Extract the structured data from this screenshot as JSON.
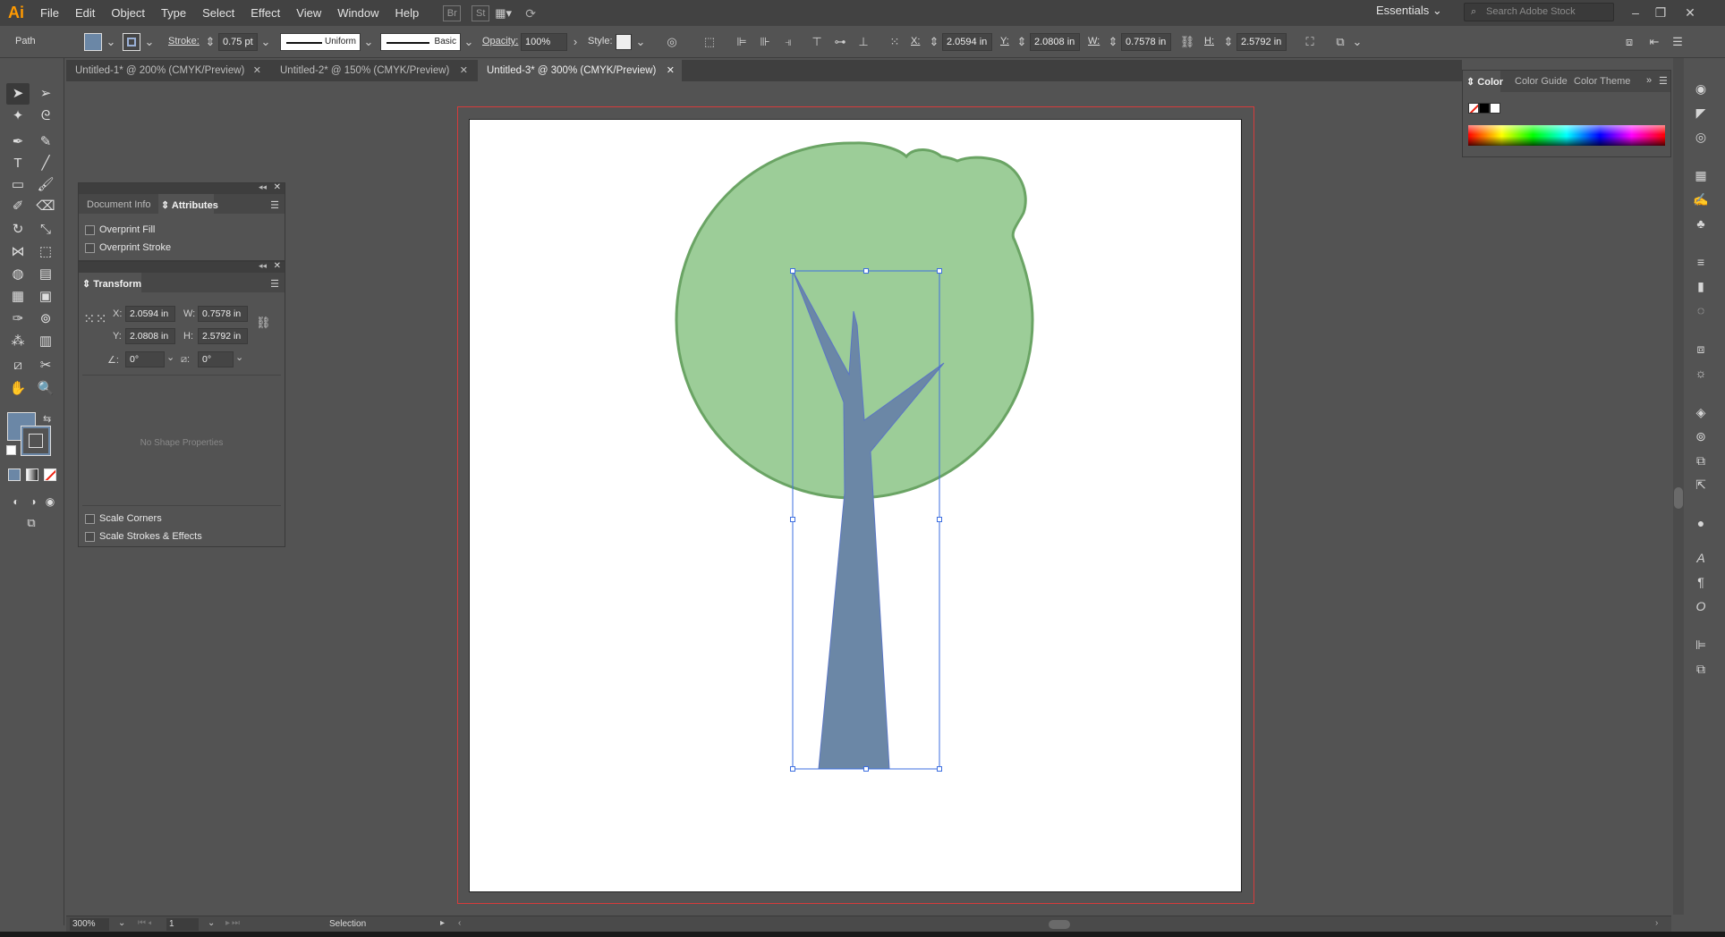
{
  "app": {
    "logo": "Ai"
  },
  "menu": [
    "File",
    "Edit",
    "Object",
    "Type",
    "Select",
    "Effect",
    "View",
    "Window",
    "Help"
  ],
  "menu_buttons": {
    "br": "Br",
    "st": "St"
  },
  "workspace": "Essentials",
  "stock_search": {
    "placeholder": "Search Adobe Stock"
  },
  "control": {
    "selection_type": "Path",
    "stroke_label": "Stroke:",
    "stroke_weight": "0.75 pt",
    "profile": "Uniform",
    "brush": "Basic",
    "opacity_label": "Opacity:",
    "opacity": "100%",
    "style_label": "Style:",
    "x_label": "X:",
    "x": "2.0594 in",
    "y_label": "Y:",
    "y": "2.0808 in",
    "w_label": "W:",
    "w": "0.7578 in",
    "h_label": "H:",
    "h": "2.5792 in"
  },
  "tabs": [
    {
      "label": "Untitled-1* @ 200% (CMYK/Preview)"
    },
    {
      "label": "Untitled-2* @ 150% (CMYK/Preview)"
    },
    {
      "label": "Untitled-3* @ 300% (CMYK/Preview)",
      "active": true
    }
  ],
  "attributes_panel": {
    "tabs": [
      "Document Info",
      "Attributes"
    ],
    "overprint_fill": "Overprint Fill",
    "overprint_stroke": "Overprint Stroke"
  },
  "transform_panel": {
    "title": "Transform",
    "x_label": "X:",
    "x": "2.0594 in",
    "y_label": "Y:",
    "y": "2.0808 in",
    "w_label": "W:",
    "w": "0.7578 in",
    "h_label": "H:",
    "h": "2.5792 in",
    "angle": "0°",
    "shear": "0°",
    "no_shape": "No Shape Properties",
    "scale_corners": "Scale Corners",
    "scale_strokes": "Scale Strokes & Effects"
  },
  "color_panel": {
    "tabs": [
      "Color",
      "Color Guide",
      "Color Theme"
    ]
  },
  "status": {
    "zoom": "300%",
    "artboard": "1",
    "tool": "Selection"
  },
  "colors": {
    "fill": "#6b87a6",
    "canopy_fill": "#9ccd98",
    "canopy_stroke": "#6aa464",
    "trunk_fill": "#6b87a6",
    "trunk_stroke": "#5a76c4",
    "selection": "#3e6fe0",
    "bleed": "#d63b3b"
  }
}
